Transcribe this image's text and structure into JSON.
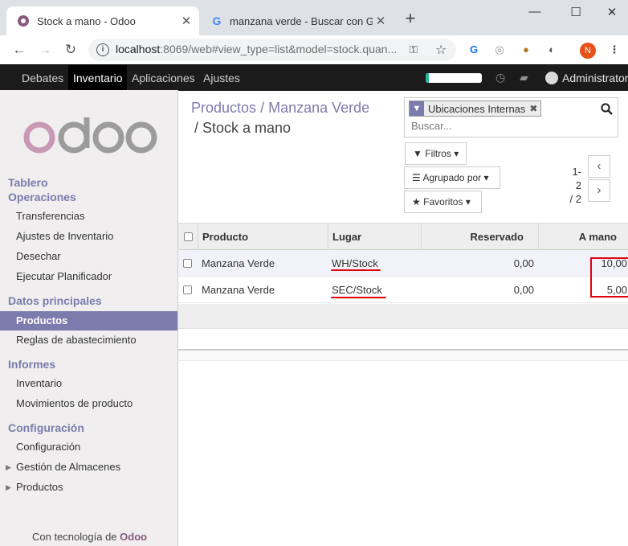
{
  "browser": {
    "tabs": [
      {
        "title": "Stock a mano - Odoo",
        "active": true
      },
      {
        "title": "manzana verde - Buscar con Goo",
        "active": false
      }
    ],
    "url_host": "localhost",
    "url_rest": ":8069/web#view_type=list&model=stock.quan...",
    "profile_initial": "N"
  },
  "odoo_nav": {
    "menus": [
      "Debates",
      "Inventario",
      "Aplicaciones",
      "Ajustes"
    ],
    "active_menu": "Inventario",
    "user": "Administrator",
    "progress": 0.05
  },
  "sidebar": {
    "sections": [
      {
        "title": "Tablero",
        "items": []
      },
      {
        "title": "Operaciones",
        "items": [
          "Transferencias",
          "Ajustes de Inventario",
          "Desechar",
          "Ejecutar Planificador"
        ]
      },
      {
        "title": "Datos principales",
        "items": [
          "Productos",
          "Reglas de abastecimiento"
        ]
      },
      {
        "title": "Informes",
        "items": [
          "Inventario",
          "Movimientos de producto"
        ]
      },
      {
        "title": "Configuración",
        "items": [
          "Configuración",
          "Gestión de Almacenes",
          "Productos"
        ]
      }
    ],
    "active_item": "Productos",
    "powered_prefix": "Con tecnología de",
    "powered_brand": "Odoo"
  },
  "control_panel": {
    "breadcrumb": [
      "Productos",
      "Manzana Verde",
      "Stock a mano"
    ],
    "search_facet": "Ubicaciones Internas",
    "search_placeholder": "Buscar...",
    "filters_label": "Filtros",
    "groupby_label": "Agrupado por",
    "favorites_label": "Favoritos",
    "pager_range": "1-2",
    "pager_total": "/ 2"
  },
  "list": {
    "columns": [
      "Producto",
      "Lugar",
      "Reservado",
      "A mano"
    ],
    "rows": [
      {
        "product": "Manzana Verde",
        "location": "WH/Stock",
        "reserved": "0,00",
        "on_hand": "10,00"
      },
      {
        "product": "Manzana Verde",
        "location": "SEC/Stock",
        "reserved": "0,00",
        "on_hand": "5,00"
      }
    ]
  },
  "colors": {
    "odoo_purple": "#7c7bad",
    "odoo_brand": "#875a7b",
    "annotation_red": "#e0000b"
  }
}
